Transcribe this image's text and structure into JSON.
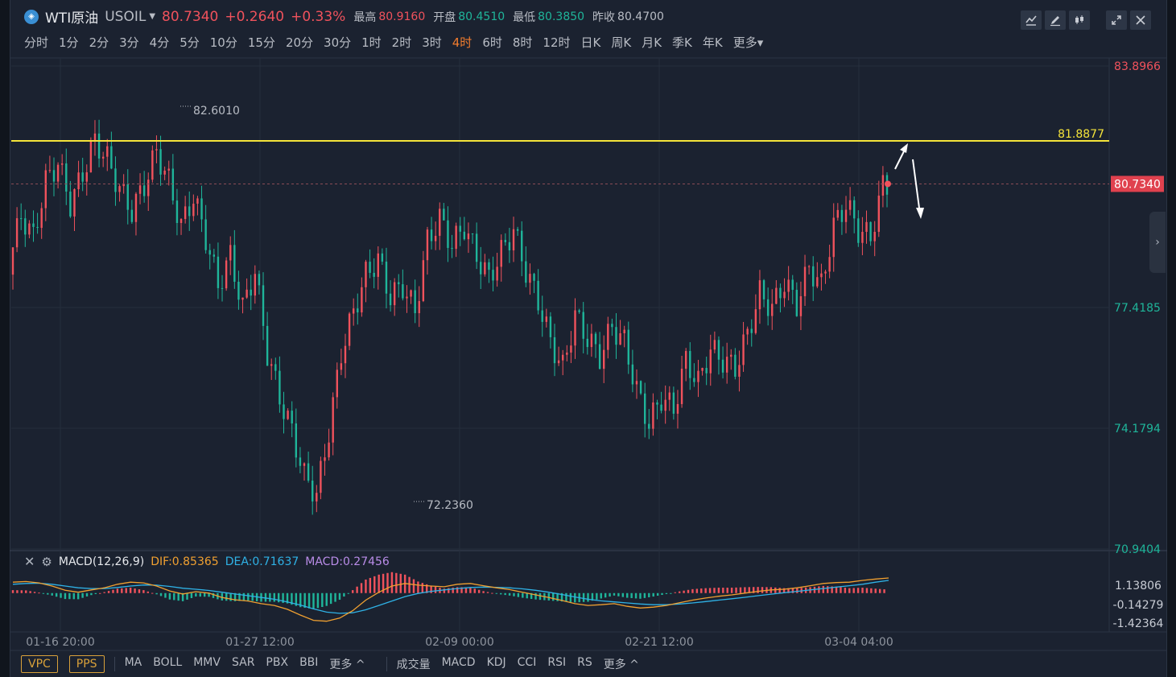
{
  "header": {
    "symbol_icon": "coin-icon",
    "name": "WTI原油",
    "code": "USOIL",
    "price": "80.7340",
    "change": "+0.2640",
    "change_pct": "+0.33%",
    "high_label": "最高",
    "high": "80.9160",
    "open_label": "开盘",
    "open": "80.4510",
    "low_label": "最低",
    "low": "80.3850",
    "prev_close_label": "昨收",
    "prev_close": "80.4700"
  },
  "timeframes": [
    "分时",
    "1分",
    "2分",
    "3分",
    "4分",
    "5分",
    "10分",
    "15分",
    "20分",
    "30分",
    "1时",
    "2时",
    "3时",
    "4时",
    "6时",
    "8时",
    "12时",
    "日K",
    "周K",
    "月K",
    "季K",
    "年K",
    "更多▾"
  ],
  "active_timeframe": "4时",
  "toolbar": {
    "icons": [
      "line-chart-icon",
      "pen-icon",
      "candles-icon",
      "expand-icon",
      "close-icon"
    ]
  },
  "macd_header": {
    "title": "MACD(12,26,9)",
    "dif": "DIF:0.85365",
    "dea": "DEA:0.71637",
    "macd": "MACD:0.27456"
  },
  "bottom_bar": {
    "vpc": "VPC",
    "pps": "PPS",
    "main_indicators": [
      "MA",
      "BOLL",
      "MMV",
      "SAR",
      "PBX",
      "BBI",
      "更多 ^"
    ],
    "sub_indicators": [
      "成交量",
      "MACD",
      "KDJ",
      "CCI",
      "RSI",
      "RS",
      "更多 ^"
    ]
  },
  "colors": {
    "up": "#f0525c",
    "down": "#1fb59a",
    "hline": "#f5e43a",
    "active": "#f07c2e",
    "dif_line": "#f0a030",
    "dea_line": "#2fb2e6",
    "macd_label": "#b98ce8"
  },
  "chart_data": [
    {
      "type": "candlestick",
      "y_axis_ticks": [
        "83.8966",
        "77.4185",
        "74.1794",
        "70.9404"
      ],
      "x_axis_ticks": [
        "01-16 20:00",
        "01-27 12:00",
        "02-09 00:00",
        "02-21 12:00",
        "03-04 04:00"
      ],
      "ylim": [
        70.9404,
        83.8966
      ],
      "high_mark": "82.6010",
      "low_mark": "72.2360",
      "horizontal_line": "81.8877",
      "last_price": "80.7340",
      "close_path": [
        78.6,
        79.9,
        79.3,
        80.8,
        81.3,
        80.2,
        81.0,
        81.9,
        81.4,
        80.6,
        80.0,
        80.7,
        81.6,
        80.8,
        79.6,
        80.4,
        79.3,
        78.0,
        78.8,
        77.4,
        78.4,
        76.2,
        75.0,
        74.1,
        72.9,
        72.4,
        74.1,
        76.2,
        77.3,
        78.3,
        78.7,
        77.7,
        78.0,
        77.3,
        79.2,
        79.8,
        79.1,
        79.6,
        78.8,
        78.2,
        78.9,
        79.5,
        78.4,
        77.6,
        76.5,
        75.8,
        77.2,
        76.6,
        76.1,
        76.9,
        76.5,
        75.2,
        74.3,
        75.0,
        74.7,
        76.0,
        75.4,
        76.3,
        76.0,
        75.8,
        76.7,
        77.8,
        77.4,
        78.1,
        77.5,
        78.5,
        78.0,
        79.6,
        80.2,
        79.5,
        79.3,
        80.7
      ],
      "y_range_series": "close_path estimated"
    },
    {
      "type": "bar",
      "title": "MACD(12,26,9)",
      "y_axis_ticks": [
        "1.13806",
        "-0.14279",
        "-1.42364"
      ],
      "series": [
        {
          "name": "DIF",
          "values": [
            0.62,
            0.66,
            0.58,
            0.4,
            0.16,
            0.05,
            0.18,
            0.3,
            0.5,
            0.62,
            0.58,
            0.4,
            0.12,
            -0.05,
            0.08,
            0.0,
            -0.25,
            -0.38,
            -0.45,
            -0.6,
            -0.7,
            -0.92,
            -1.25,
            -1.55,
            -1.6,
            -1.42,
            -1.0,
            -0.4,
            0.05,
            0.4,
            0.55,
            0.45,
            0.4,
            0.36,
            0.5,
            0.55,
            0.42,
            0.3,
            0.2,
            0.05,
            -0.1,
            -0.25,
            -0.42,
            -0.6,
            -0.7,
            -0.66,
            -0.6,
            -0.75,
            -0.85,
            -0.8,
            -0.7,
            -0.55,
            -0.4,
            -0.28,
            -0.18,
            -0.1,
            0.0,
            0.1,
            0.18,
            0.22,
            0.3,
            0.42,
            0.55,
            0.6,
            0.62,
            0.72,
            0.8,
            0.86
          ]
        },
        {
          "name": "DEA",
          "values": [
            0.5,
            0.55,
            0.56,
            0.5,
            0.4,
            0.3,
            0.26,
            0.26,
            0.32,
            0.4,
            0.46,
            0.45,
            0.38,
            0.28,
            0.22,
            0.15,
            0.05,
            -0.05,
            -0.15,
            -0.25,
            -0.35,
            -0.5,
            -0.68,
            -0.9,
            -1.08,
            -1.15,
            -1.12,
            -0.95,
            -0.7,
            -0.45,
            -0.2,
            -0.02,
            0.1,
            0.18,
            0.26,
            0.32,
            0.34,
            0.33,
            0.3,
            0.24,
            0.16,
            0.05,
            -0.08,
            -0.22,
            -0.35,
            -0.44,
            -0.5,
            -0.56,
            -0.62,
            -0.66,
            -0.66,
            -0.62,
            -0.56,
            -0.48,
            -0.4,
            -0.32,
            -0.24,
            -0.15,
            -0.06,
            0.02,
            0.1,
            0.18,
            0.26,
            0.34,
            0.42,
            0.5,
            0.62,
            0.72
          ]
        }
      ]
    }
  ]
}
